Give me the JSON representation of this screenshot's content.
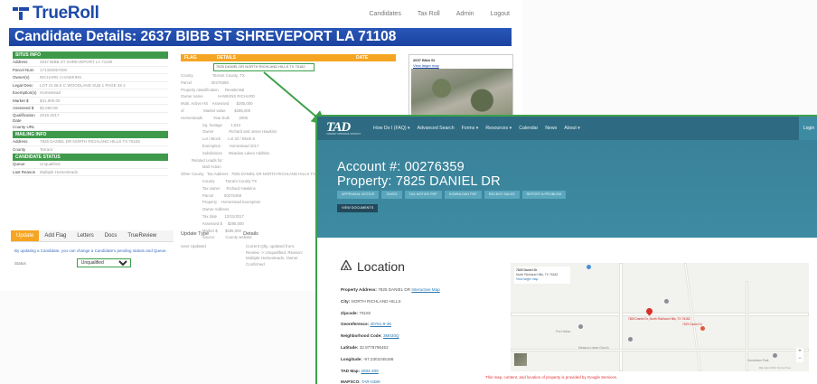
{
  "trueroll": {
    "brand": "TrueRoll",
    "nav": [
      "Candidates",
      "Tax Roll",
      "Admin",
      "Logout"
    ],
    "title": "Candidate Details: 2637 BIBB ST SHREVEPORT LA 71108",
    "situs": {
      "heading": "SITUS INFO",
      "rows": [
        {
          "k": "Address",
          "v": "2637 BIBB ST SHREVEPORT LA 71108"
        },
        {
          "k": "Parcel Num",
          "v": "171320057000"
        },
        {
          "k": "Owner(s)",
          "v": "RICHARD J HAWKINS"
        },
        {
          "k": "Legal Desc",
          "v": "LOT 21 BLK C WOODLAND SUB 1 PAGE 49 3"
        },
        {
          "k": "Exemption(s)",
          "v": "Homestead"
        },
        {
          "k": "Market $",
          "v": "$41,900.00"
        },
        {
          "k": "Assessed $",
          "v": "$2,660.00"
        },
        {
          "k": "Qualification Date",
          "v": "2015-2017"
        },
        {
          "k": "County URL",
          "v": ""
        }
      ]
    },
    "mailing": {
      "heading": "MAILING INFO",
      "rows": [
        {
          "k": "Address",
          "v": "7825 DANIEL DR NORTH RICHLAND HILLS TX 76182"
        },
        {
          "k": "County",
          "v": "Tarrant"
        }
      ]
    },
    "candidate_status": {
      "heading": "CANDIDATE STATUS",
      "rows": [
        {
          "k": "Queue",
          "v": "Unqualified"
        },
        {
          "k": "Last Reason",
          "v": "Multiple Homesteads"
        }
      ]
    },
    "flag_table": {
      "headers": [
        "FLAG",
        "DETAILS",
        "DATE"
      ],
      "highlight": "7825 DANIEL DR NORTH RICHLAND HILLS TX 76182",
      "rows": [
        "County                  Tarrant County, TX",
        "Parcel                  00276359",
        "Property classification      Residential",
        "Owner name              HAWKINS RICHARD",
        "Multi. Active HS    Assessed       $285,000",
        "of                  Market value        $285,000",
        "Homesteads          Year built         2005",
        "                    Sq. footage        1,812",
        "                    Owner              Richard and Jesse Hawkins",
        "                    Lot / Block       Lot 22 / Block 8",
        "                    Exemption        Homestead 2017",
        "                    Subdivision      Meadow Lakes Addition",
        "          Related Leads for:",
        "                    Mail Action     ",
        "Other County   Tax Address   7825 DANIEL DR NORTH RICHLAND HILLS TX",
        "                    County          Tarrant County TX",
        "                    Tax owner      Richard Hawkins",
        "                    Parcel          00276359",
        "                    Property    Homestead Exemption",
        "                    Owner Address",
        "                    Tax date       12/31/2017",
        "                    Assessed $     $285,000",
        "                    Market $       $285,000",
        "                    Source          County website"
      ]
    },
    "aerial": {
      "address": "2637 Bibb St",
      "link": "View larger map"
    },
    "bottom_tabs": [
      "Update",
      "Add Flag",
      "Letters",
      "Docs",
      "TrueReview"
    ],
    "update_cols": [
      "Update Type",
      "Details"
    ],
    "update_lbl": "User Updated",
    "update_text": "Current Qlty. updated from: Review -> Unqualified, Reason: Multiple Homesteads, Owner Confirmed",
    "queue_note": "By updating a Candidate, you can change a Candidate's pending statuts and Queue.",
    "status_label": "Status",
    "status_value": "Unqualified"
  },
  "tad": {
    "logo": "TAD",
    "logo_sub": "TARRANT APPRAISAL DISTRICT",
    "menu": [
      "How Do I (FAQ) ▾",
      "Advanced Search",
      "Forms ▾",
      "Resources ▾",
      "Calendar",
      "News",
      "About ▾"
    ],
    "right_btn": "Login",
    "account": "Account #: 00276359",
    "property": "Property: 7825 DANIEL DR",
    "buttons": [
      "APPRAISAL NOTICE",
      "TAXES",
      "TAX NOTICE PDF",
      "DOWNLOAD PDF",
      "RECENT SALES",
      "REPORT A PROBLEM"
    ],
    "doc_button": "VIEW DOCUMENTS",
    "location_title": "Location",
    "location_rows": [
      {
        "label": "Property Address:",
        "value": "7825 DANIEL DR",
        "link": "Interactive Map"
      },
      {
        "label": "City:",
        "value": "NORTH RICHLAND HILLS",
        "link": ""
      },
      {
        "label": "Zipcode:",
        "value": "76182",
        "link": ""
      },
      {
        "label": "Georeference:",
        "value": "",
        "link": "40751-8-35"
      },
      {
        "label": "Neighborhood Code:",
        "value": "",
        "link": "3M030Q"
      },
      {
        "label": "Latitude:",
        "value": "32.8778796452",
        "link": ""
      },
      {
        "label": "Longitude:",
        "value": "-97.2301045166",
        "link": ""
      },
      {
        "label": "TAD Map:",
        "value": "",
        "link": "2084-408"
      },
      {
        "label": "MAPSCO:",
        "value": "",
        "link": "TAR-038K"
      }
    ],
    "map": {
      "infobox_title": "7825 Daniel Dr",
      "infobox_sub": "North Richland Hills, TX 76182",
      "infobox_link": "View larger map",
      "pin_label": "7825 Daniel Dr, North Richland Hills, TX 76182",
      "pin2_label": "7829 Daniel Dr",
      "poi_labels": [
        "Fox Hollow",
        "Meadow Lakes Church",
        "Hometown Park"
      ],
      "attribution": "Map data ©2021  Terms of Use"
    },
    "map_note": "This map, content, and location of property is provided by Google Services."
  },
  "colors": {
    "trueroll_blue": "#1e4aa8",
    "section_green": "#3e9a4a",
    "flag_orange": "#f6a523",
    "tad_teal": "#3a8299",
    "highlight_green": "#3ea14a",
    "pin_red": "#d93025"
  },
  "icons": {
    "logo": "trueroll-logo-icon",
    "location": "location-triangle-icon",
    "pin": "map-pin-icon"
  }
}
